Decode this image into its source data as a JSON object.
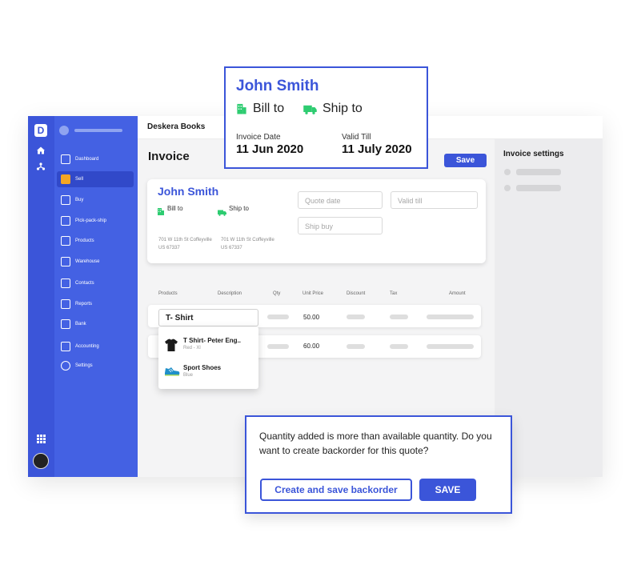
{
  "app": {
    "logo_letter": "D",
    "title": "Deskera Books",
    "accent_color": "#3b55d9"
  },
  "sidebar": {
    "items": [
      {
        "label": "Dashboard",
        "icon": "dashboard-icon"
      },
      {
        "label": "Sell",
        "icon": "sell-icon",
        "active": true
      },
      {
        "label": "Buy",
        "icon": "buy-icon"
      },
      {
        "label": "Pick-pack-ship",
        "icon": "pick-pack-ship-icon"
      },
      {
        "label": "Products",
        "icon": "products-icon"
      },
      {
        "label": "Warehouse",
        "icon": "warehouse-icon"
      },
      {
        "label": "Contacts",
        "icon": "contacts-icon"
      },
      {
        "label": "Reports",
        "icon": "reports-icon"
      },
      {
        "label": "Bank",
        "icon": "bank-icon"
      },
      {
        "label": "Accounting",
        "icon": "accounting-icon"
      },
      {
        "label": "Settings",
        "icon": "settings-icon"
      }
    ]
  },
  "invoice": {
    "title": "Invoice",
    "save_label": "Save",
    "customer_name": "John Smith",
    "bill_to_label": "Bill to",
    "ship_to_label": "Ship to",
    "bill_address_line1": "701 W 11th St Coffeyville",
    "bill_address_line2": "US 67337",
    "ship_address_line1": "701 W 11th St Coffeyville",
    "ship_address_line2": "US 67337",
    "quote_date_placeholder": "Quote date",
    "valid_till_placeholder": "Valid till",
    "ship_buy_placeholder": "Ship buy"
  },
  "table": {
    "headers": [
      "Products",
      "Description",
      "Qty",
      "Unit Price",
      "Discount",
      "Tax",
      "Amount"
    ],
    "rows": [
      {
        "product": "T- Shirt",
        "unit_price": "50.00"
      },
      {
        "product": "",
        "unit_price": "60.00"
      }
    ]
  },
  "dropdown": {
    "options": [
      {
        "name": "T Shirt- Peter Eng..",
        "sub": "Red - Xl"
      },
      {
        "name": "Sport Shoes",
        "sub": "Blue"
      }
    ]
  },
  "settings_panel": {
    "title": "Invoice settings"
  },
  "customer_popup": {
    "name": "John Smith",
    "bill_to_label": "Bill to",
    "ship_to_label": "Ship to",
    "invoice_date_label": "Invoice Date",
    "invoice_date": "11 Jun 2020",
    "valid_till_label": "Valid Till",
    "valid_till": "11 July 2020"
  },
  "backorder_popup": {
    "message": "Quantity added is more than available quantity. Do you want to create backorder for this quote?",
    "create_label": "Create and save backorder",
    "save_label": "SAVE"
  }
}
